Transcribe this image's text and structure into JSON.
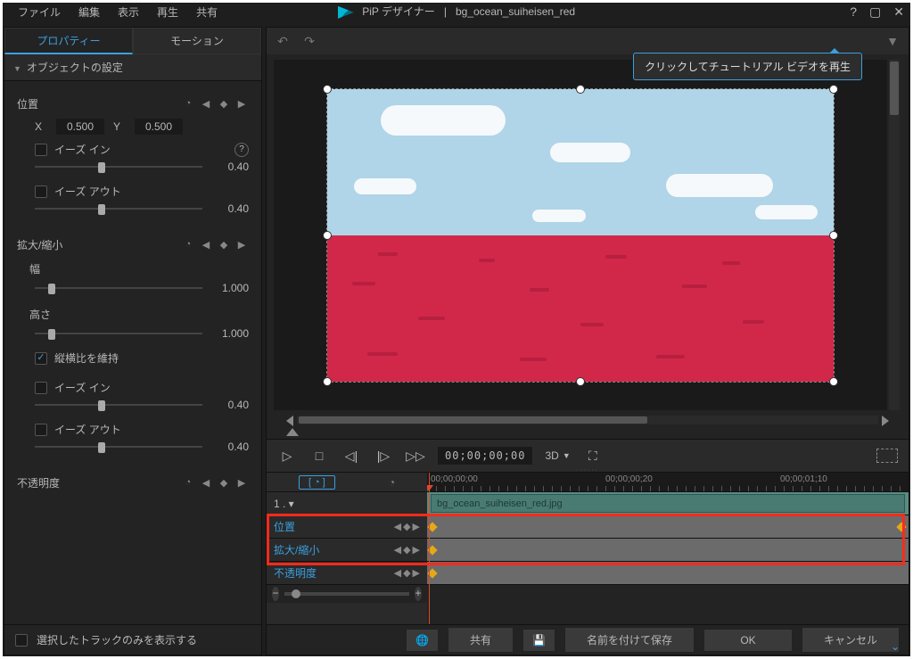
{
  "menubar": {
    "file": "ファイル",
    "edit": "編集",
    "view": "表示",
    "play": "再生",
    "share": "共有"
  },
  "title": {
    "app": "PiP デザイナー",
    "sep": "|",
    "file": "bg_ocean_suiheisen_red"
  },
  "tabs": {
    "properties": "プロパティー",
    "motion": "モーション"
  },
  "section": {
    "object_settings": "オブジェクトの設定"
  },
  "position": {
    "label": "位置",
    "x_label": "X",
    "x_val": "0.500",
    "y_label": "Y",
    "y_val": "0.500",
    "ease_in": "イーズ イン",
    "ease_in_val": "0.40",
    "ease_out": "イーズ アウト",
    "ease_out_val": "0.40"
  },
  "scale": {
    "label": "拡大/縮小",
    "width_label": "幅",
    "width_val": "1.000",
    "height_label": "高さ",
    "height_val": "1.000",
    "keep_aspect": "縦横比を維持",
    "ease_in": "イーズ イン",
    "ease_in_val": "0.40",
    "ease_out": "イーズ アウト",
    "ease_out_val": "0.40"
  },
  "opacity": {
    "label": "不透明度"
  },
  "tooltip": "クリックしてチュートリアル ビデオを再生",
  "playback": {
    "timecode": "00;00;00;00",
    "three_d": "3D"
  },
  "ruler": {
    "t0": "00;00;00;00",
    "t1": "00;00;00;20",
    "t2": "00;00;01;10"
  },
  "tracks": {
    "clip_name": "bg_ocean_suiheisen_red.jpg",
    "position": "位置",
    "scale": "拡大/縮小",
    "opacity": "不透明度"
  },
  "bottom": {
    "show_selected_only": "選択したトラックのみを表示する",
    "share": "共有",
    "save_as": "名前を付けて保存",
    "ok": "OK",
    "cancel": "キャンセル"
  }
}
